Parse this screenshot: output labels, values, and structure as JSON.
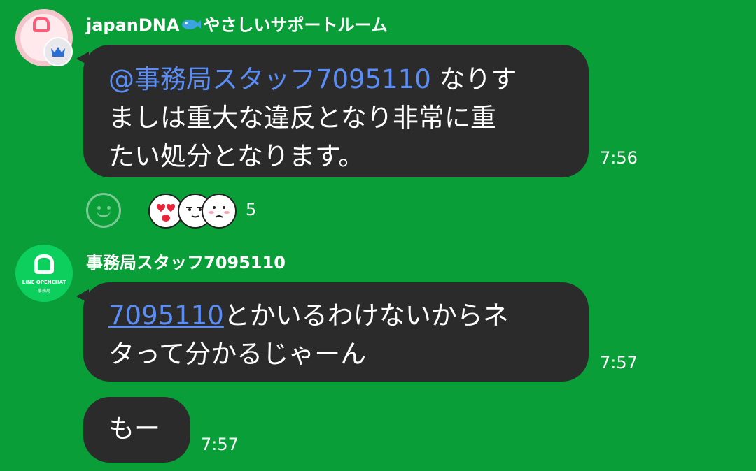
{
  "messages": [
    {
      "sender": "japanDNA",
      "sender_suffix": "やさしいサポートルーム",
      "avatar_icon": "room-avatar-icon",
      "badge_icon": "crown-icon",
      "mention": "@事務局スタッフ7095110",
      "lines": [
        " なりす",
        "ましは重大な違反となり非常に重",
        "たい処分となります。"
      ],
      "time": "7:56",
      "reactions": {
        "icons": [
          "heart-eyes-sticker-icon",
          "smug-face-sticker-icon",
          "blushing-face-sticker-icon"
        ],
        "count": "5"
      }
    },
    {
      "sender": "事務局スタッフ7095110",
      "avatar_lines": [
        "LINE OPENCHAT",
        "事務局"
      ],
      "link": "7095110",
      "lines": [
        "とかいるわけないからネ",
        "タって分かるじゃーん"
      ],
      "time": "7:57"
    },
    {
      "text": "もー",
      "time": "7:57"
    }
  ],
  "colors": {
    "background": "#0a9e38",
    "bubble": "#2b2b2b",
    "mention": "#5b8df6"
  }
}
